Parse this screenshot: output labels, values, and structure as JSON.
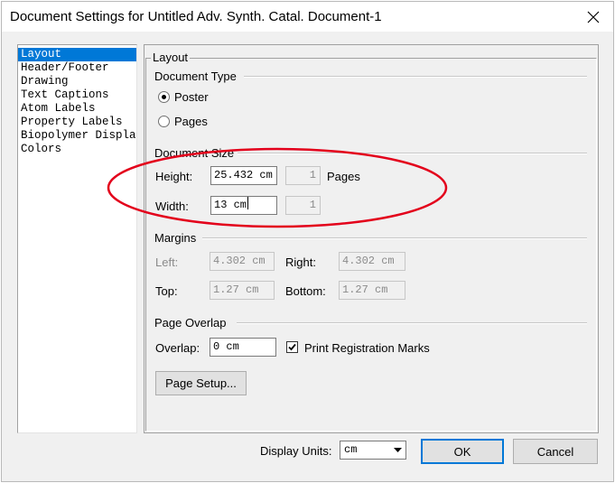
{
  "window": {
    "title": "Document Settings for Untitled Adv. Synth. Catal. Document-1"
  },
  "categories": [
    {
      "label": "Layout",
      "selected": true
    },
    {
      "label": "Header/Footer"
    },
    {
      "label": "Drawing"
    },
    {
      "label": "Text Captions"
    },
    {
      "label": "Atom Labels"
    },
    {
      "label": "Property Labels"
    },
    {
      "label": "Biopolymer Displa"
    },
    {
      "label": "Colors"
    }
  ],
  "layout": {
    "group_label": "Layout",
    "document_type": {
      "label": "Document Type",
      "poster_label": "Poster",
      "pages_label": "Pages",
      "selected": "Poster"
    },
    "document_size": {
      "label": "Document Size",
      "height_label": "Height:",
      "height_value": "25.432 cm",
      "height_pages": "1",
      "pages_label": "Pages",
      "width_label": "Width:",
      "width_value": "13 cm",
      "width_pages": "1"
    },
    "margins": {
      "label": "Margins",
      "left_label": "Left:",
      "left_value": "4.302 cm",
      "right_label": "Right:",
      "right_value": "4.302 cm",
      "top_label": "Top:",
      "top_value": "1.27 cm",
      "bottom_label": "Bottom:",
      "bottom_value": "1.27 cm"
    },
    "page_overlap": {
      "label": "Page Overlap",
      "overlap_label": "Overlap:",
      "overlap_value": "0 cm",
      "print_marks_label": "Print Registration Marks",
      "print_marks_checked": true
    },
    "page_setup_label": "Page Setup..."
  },
  "footer": {
    "display_units_label": "Display Units:",
    "display_units_value": "cm",
    "ok_label": "OK",
    "cancel_label": "Cancel"
  },
  "annotation": {
    "color": "#e3001b"
  },
  "icons": {
    "close": "close-icon",
    "dropdown": "chevron-down-icon",
    "checkbox": "checkmark-icon"
  }
}
